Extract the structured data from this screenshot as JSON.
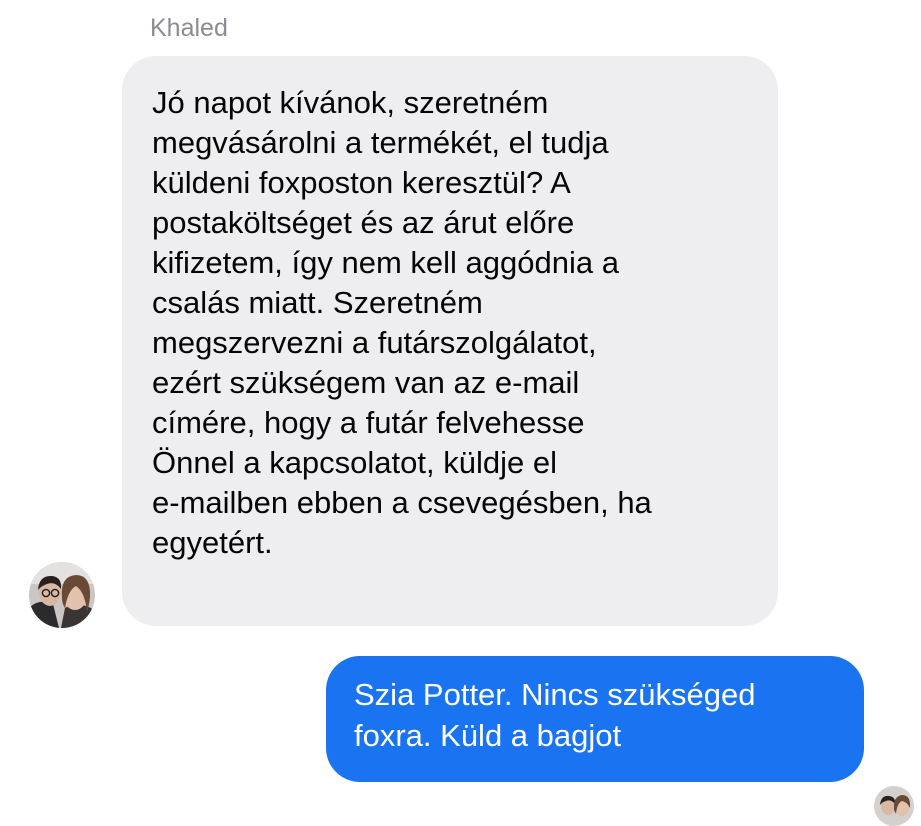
{
  "conversation": {
    "sender_name": "Khaled",
    "received_message": {
      "text": "Jó napot kívánok, szeretném\nmegvásárolni a termékét, el tudja\nküldeni foxposton keresztül? A\npostaköltséget és az árut előre\nkifizetem, így nem kell aggódnia a\ncsalás miatt. Szeretném\nmegszervezni a futárszolgálatot,\nezért szükségem van az e-mail\ncímére, hogy a futár felvehesse\nÖnnel a kapcsolatot, küldje el\ne-mailben ebben a csevegésben, ha\negyetért."
    },
    "sent_message": {
      "text": "Szia Potter. Nincs szükséged\nfoxra. Küld a bagjot"
    }
  },
  "colors": {
    "received_bubble": "#eeeef0",
    "sent_bubble": "#1a73f0",
    "sender_name": "#8a8d91"
  }
}
